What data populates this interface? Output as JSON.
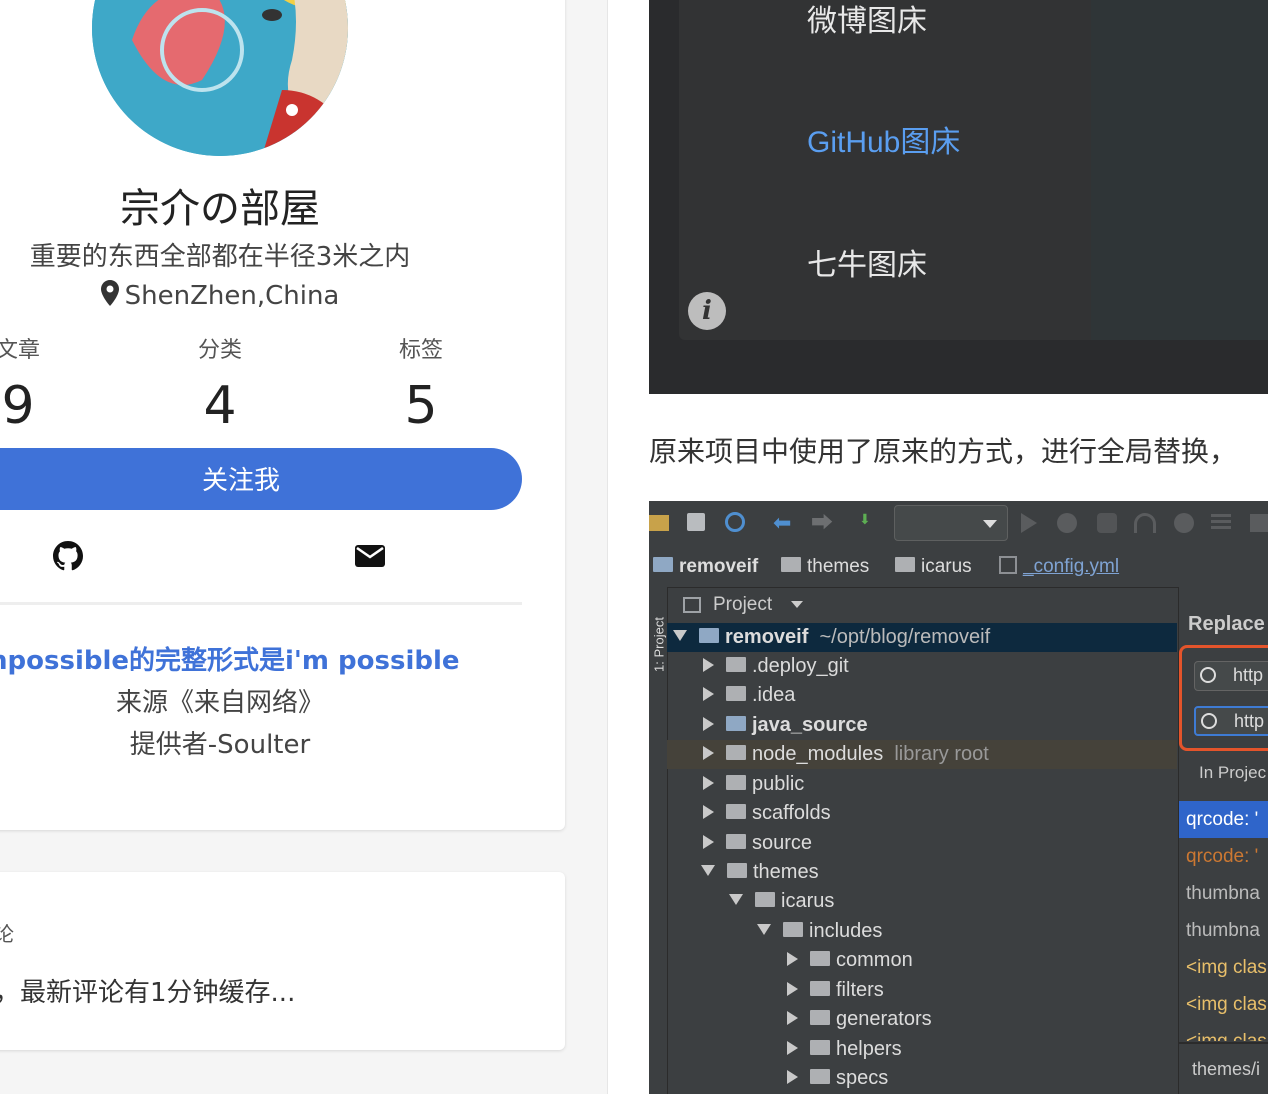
{
  "profile": {
    "title": "宗介の部屋",
    "subtitle": "重要的东西全部都在半径3米之内",
    "location": "ShenZhen,China",
    "stats": [
      {
        "label": "文章",
        "value": "9"
      },
      {
        "label": "分类",
        "value": "4"
      },
      {
        "label": "标签",
        "value": "5"
      }
    ],
    "follow_label": "关注我",
    "icons": [
      "github-icon",
      "email-icon"
    ]
  },
  "quote": {
    "text": "mpossible的完整形式是i'm possible",
    "source": "来源《来自网络》",
    "provider": "提供者-Soulter"
  },
  "comments": {
    "heading": "论",
    "note": "，最新评论有1分钟缓存..."
  },
  "screenshot1": {
    "items": [
      "微博图床",
      "GitHub图床",
      "七牛图床"
    ],
    "selected": "GitHub图床",
    "info_icon": "i"
  },
  "paragraph": "原来项目中使用了原来的方式，进行全局替换，",
  "ide": {
    "breadcrumb": [
      "removeif",
      "themes",
      "icarus",
      "_config.yml"
    ],
    "side_tab": "1: Project",
    "project_label": "Project",
    "tree": [
      {
        "name": "removeif",
        "extra": "~/opt/blog/removeif"
      },
      {
        "name": ".deploy_git"
      },
      {
        "name": ".idea"
      },
      {
        "name": "java_source"
      },
      {
        "name": "node_modules",
        "extra": "library root"
      },
      {
        "name": "public"
      },
      {
        "name": "scaffolds"
      },
      {
        "name": "source"
      },
      {
        "name": "themes"
      },
      {
        "name": "icarus"
      },
      {
        "name": "includes"
      },
      {
        "name": "common"
      },
      {
        "name": "filters"
      },
      {
        "name": "generators"
      },
      {
        "name": "helpers"
      },
      {
        "name": "specs"
      }
    ],
    "replace": {
      "title": "Replace",
      "search_value": "http",
      "replace_value": "http",
      "scope": "In Projec",
      "results": [
        "qrcode: '",
        "qrcode: '",
        "thumbna",
        "thumbna",
        "<img clas",
        "<img clas",
        "<img clas"
      ],
      "footer": "themes/i"
    },
    "colors": {
      "accent": "#3f72d8",
      "highlight": "#e4542b",
      "selected_row": "#2f65ca"
    }
  }
}
